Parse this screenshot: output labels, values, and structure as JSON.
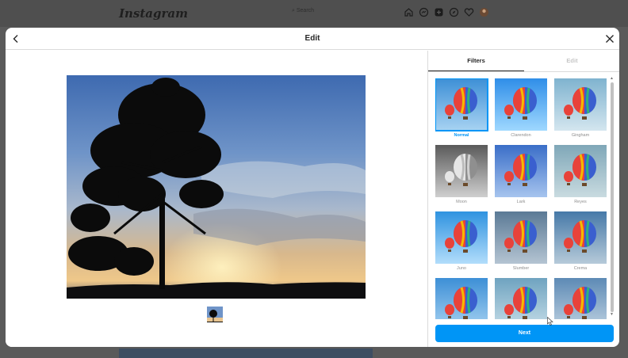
{
  "app": {
    "logo": "Instagram",
    "search_placeholder": "Search"
  },
  "nav_icons": [
    "home-icon",
    "messenger-icon",
    "new-post-icon",
    "explore-icon",
    "heart-icon",
    "avatar"
  ],
  "modal": {
    "title": "Edit",
    "tabs": [
      {
        "label": "Filters",
        "active": true
      },
      {
        "label": "Edit",
        "active": false
      }
    ],
    "filters": [
      {
        "label": "Normal",
        "selected": true
      },
      {
        "label": "Clarendon",
        "selected": false
      },
      {
        "label": "Gingham",
        "selected": false
      },
      {
        "label": "Moon",
        "selected": false
      },
      {
        "label": "Lark",
        "selected": false
      },
      {
        "label": "Reyes",
        "selected": false
      },
      {
        "label": "Juno",
        "selected": false
      },
      {
        "label": "Slumber",
        "selected": false
      },
      {
        "label": "Crema",
        "selected": false
      },
      {
        "label": "",
        "selected": false
      },
      {
        "label": "",
        "selected": false
      },
      {
        "label": "",
        "selected": false
      }
    ],
    "next_label": "Next"
  },
  "colors": {
    "accent": "#0095f6",
    "border": "#dbdbdb",
    "muted_text": "#8e8e8e"
  }
}
